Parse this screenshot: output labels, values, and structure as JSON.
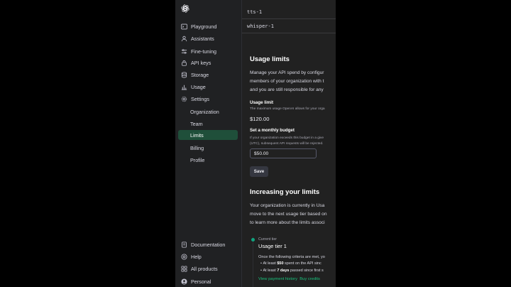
{
  "sidebar": {
    "logo": "openai-logo",
    "items": [
      {
        "label": "Playground",
        "icon": "terminal-icon"
      },
      {
        "label": "Assistants",
        "icon": "users-icon"
      },
      {
        "label": "Fine-tuning",
        "icon": "sliders-icon"
      },
      {
        "label": "API keys",
        "icon": "lock-icon"
      },
      {
        "label": "Storage",
        "icon": "database-icon"
      },
      {
        "label": "Usage",
        "icon": "bar-chart-icon"
      },
      {
        "label": "Settings",
        "icon": "gear-icon"
      }
    ],
    "settings_subitems": [
      "Organization",
      "Team",
      "Limits",
      "Billing",
      "Profile"
    ],
    "active_subitem": "Limits",
    "footer": [
      {
        "label": "Documentation",
        "icon": "document-icon"
      },
      {
        "label": "Help",
        "icon": "help-icon"
      },
      {
        "label": "All products",
        "icon": "grid-icon"
      },
      {
        "label": "Personal",
        "icon": "avatar-icon"
      }
    ]
  },
  "models": [
    "tts-1",
    "whisper-1"
  ],
  "usage_limits": {
    "title": "Usage limits",
    "description_lines": [
      "Manage your API spend by configur",
      "members of your organization with t",
      "and you are still responsible for any"
    ],
    "usage_limit_label": "Usage limit",
    "usage_limit_desc": "The maximum usage OpenAI allows for your orga",
    "usage_limit_value": "$120.00",
    "budget_label": "Set a monthly budget",
    "budget_desc_lines": [
      "If your organization exceeds this budget in a give",
      "(UTC), subsequent API requests will be rejected."
    ],
    "budget_value": "$50.00",
    "save_label": "Save"
  },
  "increasing": {
    "title": "Increasing your limits",
    "lines": [
      "Your organization is currently in Usa",
      "move to the next usage tier based on",
      "to learn more about the limits associ"
    ],
    "current_tier_label": "Current tier",
    "current_tier": "Usage tier 1",
    "criteria_intro": "Once the following criteria are met, yo",
    "criteria": [
      {
        "bold": "$50",
        "pre": "At least ",
        "post": " spent on the API sinc"
      },
      {
        "bold": "7 days",
        "pre": "At least ",
        "post": " passed since first s"
      }
    ],
    "links": [
      "View payment history",
      "Buy credits"
    ]
  },
  "colors": {
    "accent": "#10a37f",
    "active_bg": "#1f4f3a",
    "sidebar_bg": "#202123",
    "main_bg": "#212121"
  }
}
